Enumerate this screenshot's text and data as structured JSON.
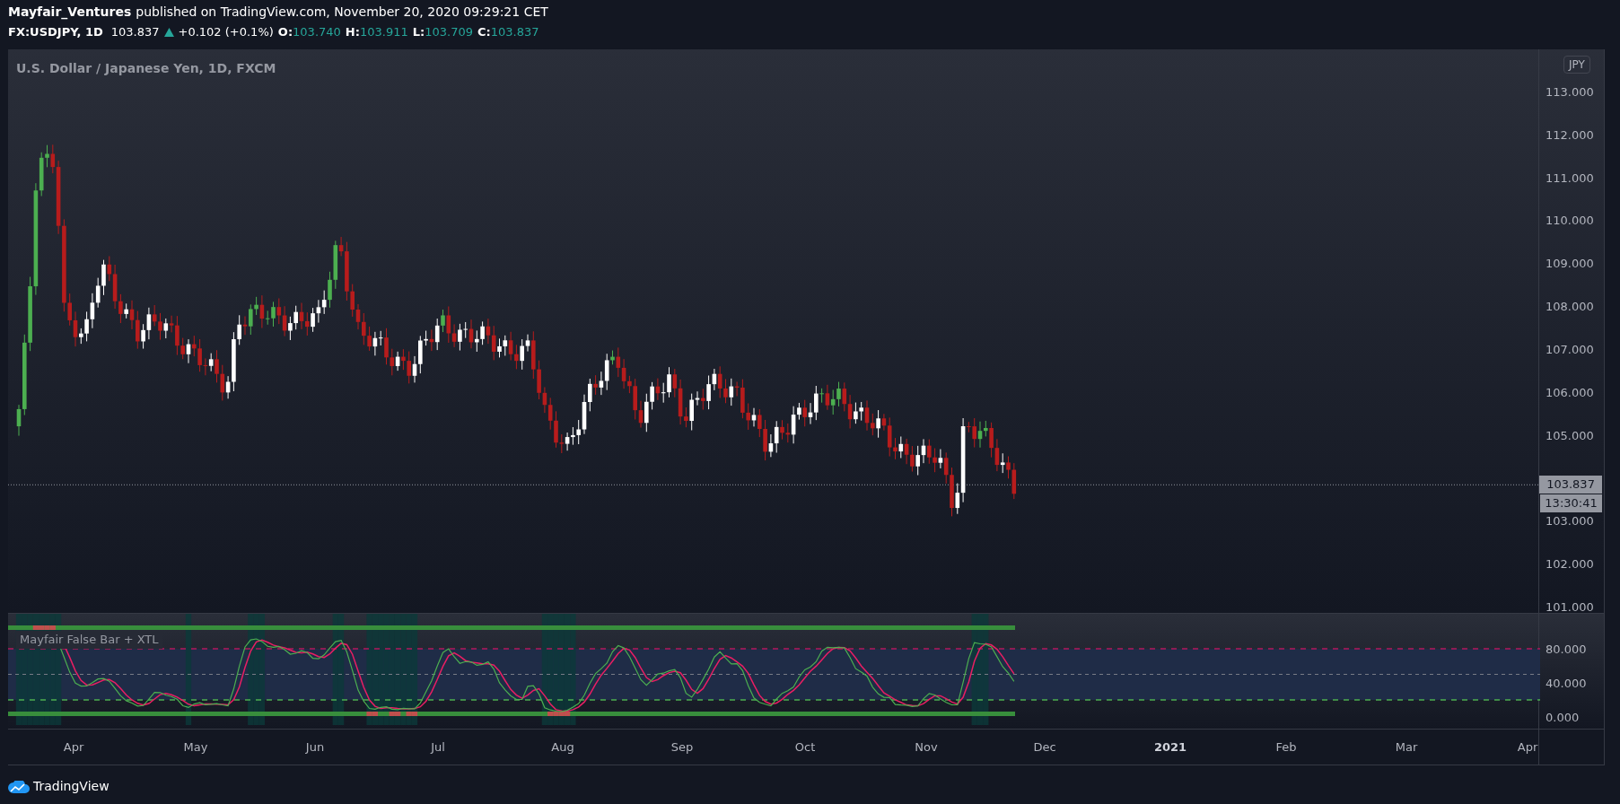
{
  "header": {
    "author": "Mayfair_Ventures",
    "published": "published on TradingView.com, November 20, 2020 09:29:21 CET",
    "symbol": "FX:USDJPY, 1D",
    "last": "103.837",
    "change": "+0.102 (+0.1%)",
    "ohlc": [
      {
        "label": "O:",
        "value": "103.740"
      },
      {
        "label": "H:",
        "value": "103.911"
      },
      {
        "label": "L:",
        "value": "103.709"
      },
      {
        "label": "C:",
        "value": "103.837"
      }
    ]
  },
  "chart": {
    "title": "U.S. Dollar / Japanese Yen, 1D, FXCM",
    "currency": "JPY",
    "price_ticks": [
      "113.000",
      "112.000",
      "111.000",
      "110.000",
      "109.000",
      "108.000",
      "107.000",
      "106.000",
      "105.000",
      "103.000",
      "102.000",
      "101.000"
    ],
    "last_price": "103.837",
    "countdown": "13:30:41"
  },
  "indicator": {
    "title": "Mayfair False Bar + XTL",
    "ticks": [
      "80.000",
      "40.000",
      "0.000"
    ]
  },
  "time_axis": [
    {
      "label": "Apr",
      "kind": "month"
    },
    {
      "label": "May",
      "kind": "month"
    },
    {
      "label": "Jun",
      "kind": "month"
    },
    {
      "label": "Jul",
      "kind": "month"
    },
    {
      "label": "Aug",
      "kind": "month"
    },
    {
      "label": "Sep",
      "kind": "month"
    },
    {
      "label": "Oct",
      "kind": "month"
    },
    {
      "label": "Nov",
      "kind": "month"
    },
    {
      "label": "Dec",
      "kind": "month"
    },
    {
      "label": "2021",
      "kind": "year"
    },
    {
      "label": "Feb",
      "kind": "month"
    },
    {
      "label": "Mar",
      "kind": "month"
    },
    {
      "label": "Apr",
      "kind": "month"
    }
  ],
  "footer": {
    "brand": "TradingView"
  }
}
